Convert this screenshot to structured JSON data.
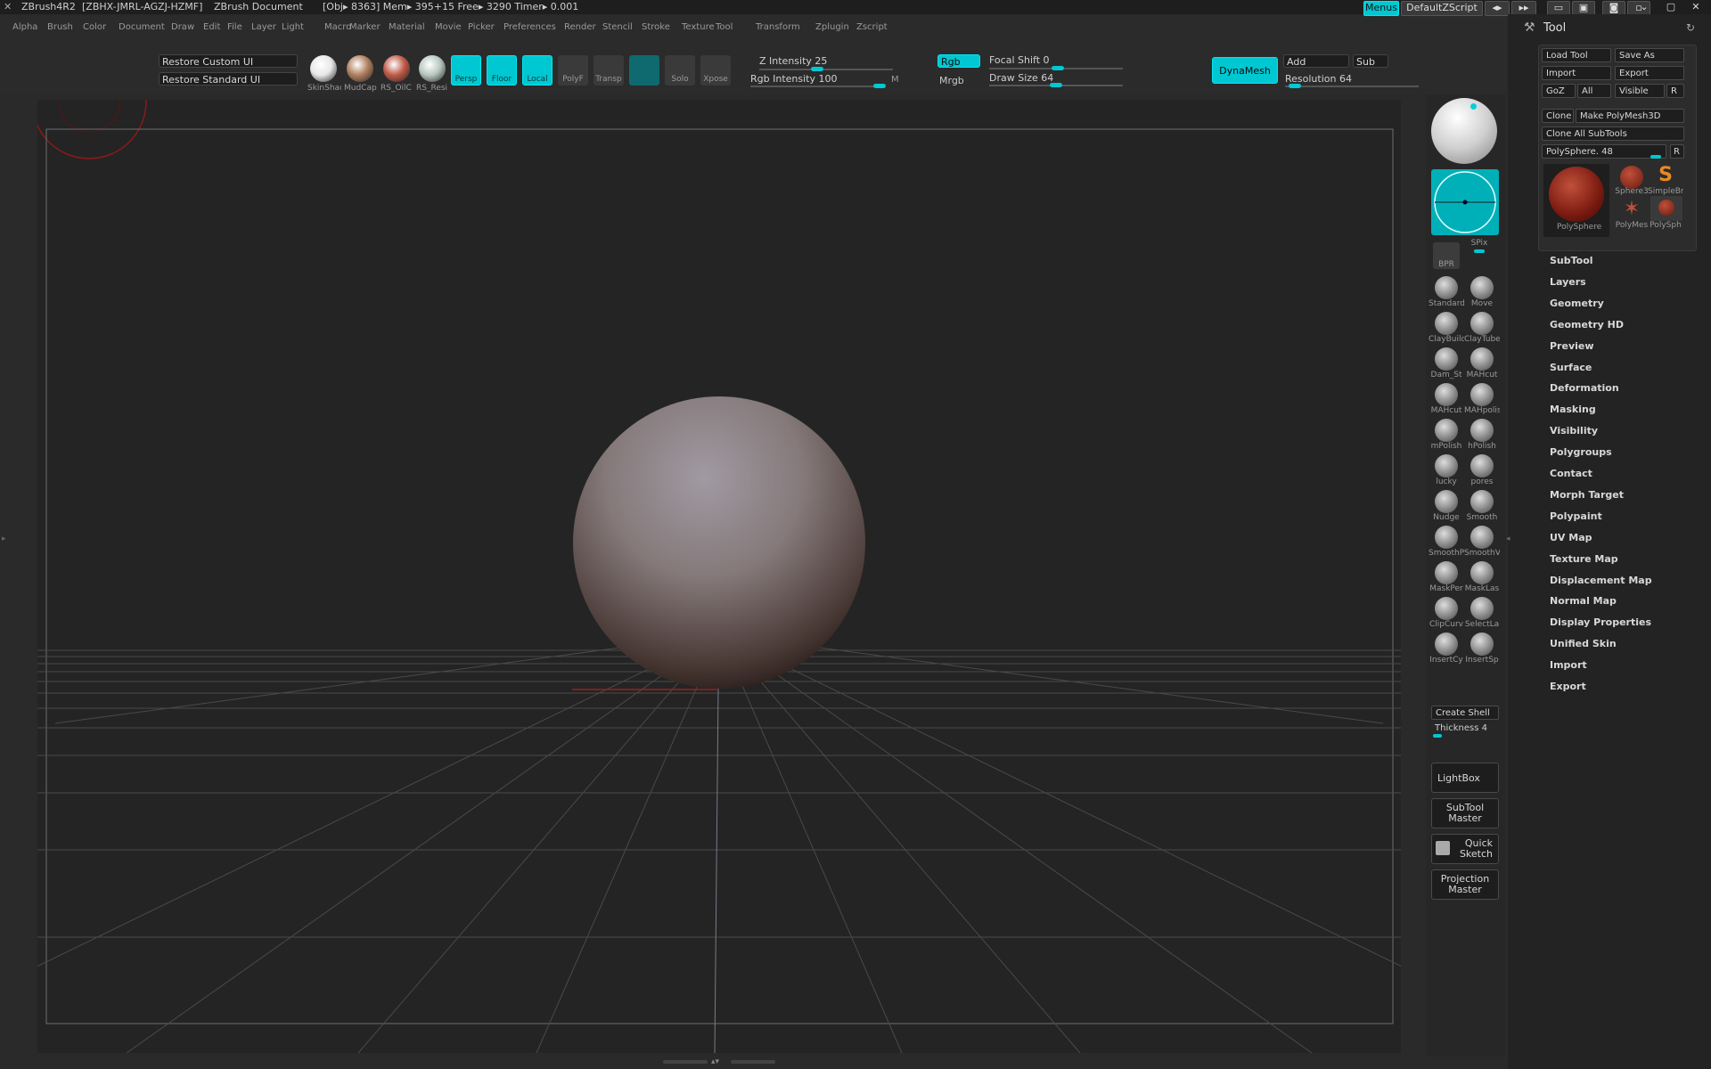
{
  "titlebar": {
    "app": "ZBrush4R2",
    "serial": "[ZBHX-JMRL-AGZJ-HZMF]",
    "document": "ZBrush Document",
    "stats": "[Obj▸ 8363] Mem▸ 395+15 Free▸ 3290 Timer▸ 0.001",
    "menus_label": "Menus",
    "script_label": "DefaultZScript"
  },
  "menubar": [
    "Alpha",
    "Brush",
    "Color",
    "Document",
    "Draw",
    "Edit",
    "File",
    "Layer",
    "Light",
    "Macro",
    "Marker",
    "Material",
    "Movie",
    "Picker",
    "Preferences",
    "Render",
    "Stencil",
    "Stroke",
    "Texture",
    "Tool",
    "Transform",
    "Zplugin",
    "Zscript"
  ],
  "shelf": {
    "restore_custom": "Restore Custom UI",
    "restore_standard": "Restore Standard UI",
    "materials": [
      {
        "label": "SkinShad",
        "color": "#e8e8e8"
      },
      {
        "label": "MudCap",
        "color": "#b08060"
      },
      {
        "label": "RS_OilC",
        "color": "#c05a48"
      },
      {
        "label": "RS_Resi",
        "color": "#b8c8c0"
      }
    ],
    "tools": [
      {
        "label": "Persp",
        "on": true
      },
      {
        "label": "Floor",
        "on": true
      },
      {
        "label": "Local",
        "on": true
      },
      {
        "label": "PolyF",
        "on": false
      },
      {
        "label": "Transp",
        "on": false
      },
      {
        "label": "",
        "on": false
      },
      {
        "label": "Solo",
        "on": false
      },
      {
        "label": "Xpose",
        "on": false
      }
    ],
    "z_intensity": "Z Intensity 25",
    "z_intensity_value": 25,
    "rgb_intensity": "Rgb Intensity 100",
    "rgb_intensity_value": 100,
    "m_label": "M",
    "rgb": "Rgb",
    "mrgb": "Mrgb",
    "focal_shift": "Focal Shift 0",
    "draw_size": "Draw Size 64",
    "dynamesh": "DynaMesh",
    "add": "Add",
    "sub": "Sub",
    "resolution": "Resolution 64"
  },
  "rightshelf": {
    "spix": "SPix",
    "bpr": "BPR",
    "brushes": [
      "Standard",
      "Move",
      "ClayBuild",
      "ClayTube",
      "Dam_St",
      "MAHcut",
      "MAHcut",
      "MAHpolis",
      "mPolish",
      "hPolish",
      "lucky",
      "pores",
      "Nudge",
      "Smooth",
      "SmoothP",
      "SmoothV",
      "MaskPer",
      "MaskLas",
      "ClipCurv",
      "SelectLa",
      "InsertCy",
      "InsertSp"
    ],
    "create_shell": "Create Shell",
    "thickness": "Thickness 4",
    "lightbox": "LightBox",
    "subtool_master": "SubTool Master",
    "quick_sketch": "Quick Sketch",
    "projection_master": "Projection Master"
  },
  "tray": {
    "title": "Tool",
    "load_tool": "Load Tool",
    "save_as": "Save As",
    "import": "Import",
    "export": "Export",
    "goz": "GoZ",
    "all": "All",
    "visible": "Visible",
    "r": "R",
    "clone": "Clone",
    "make_polymesh": "Make PolyMesh3D",
    "clone_all": "Clone  All SubTools",
    "current_tool": "PolySphere. 48",
    "thumbs": [
      {
        "label": "PolySphere"
      },
      {
        "label": "Sphere3"
      },
      {
        "label": "SimpleBr"
      },
      {
        "label": "PolyMes"
      },
      {
        "label": "PolySph"
      }
    ],
    "sections": [
      "SubTool",
      "Layers",
      "Geometry",
      "Geometry HD",
      "Preview",
      "Surface",
      "Deformation",
      "Masking",
      "Visibility",
      "Polygroups",
      "Contact",
      "Morph Target",
      "Polypaint",
      "UV Map",
      "Texture Map",
      "Displacement Map",
      "Normal Map",
      "Display Properties",
      "Unified Skin",
      "Import",
      "Export"
    ]
  },
  "colors": {
    "accent": "#00c8d2",
    "background": "#2a2a2a",
    "viewport": "#242424",
    "sphere": "#8a7e7a"
  }
}
